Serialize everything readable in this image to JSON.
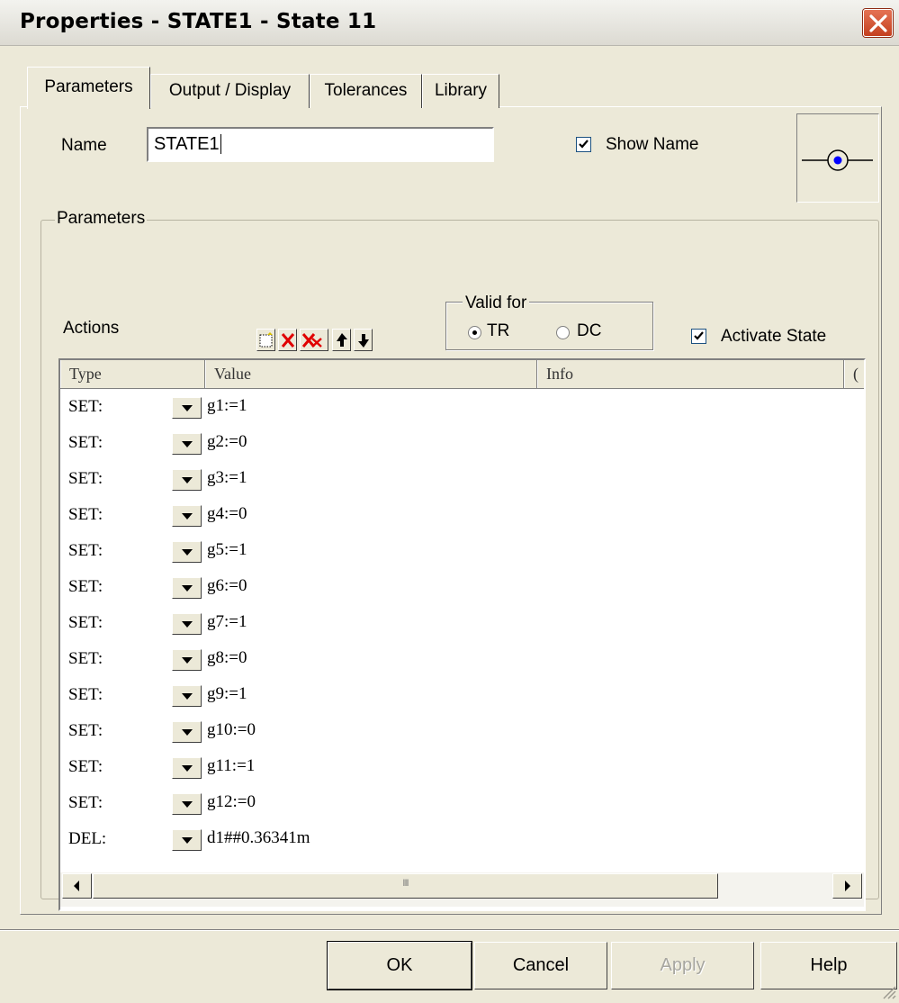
{
  "window": {
    "title": "Properties - STATE1 - State 11",
    "close_label": "close"
  },
  "tabs": [
    {
      "label": "Parameters",
      "active": true
    },
    {
      "label": "Output / Display",
      "active": false
    },
    {
      "label": "Tolerances",
      "active": false
    },
    {
      "label": "Library",
      "active": false
    }
  ],
  "name_field": {
    "label": "Name",
    "value": "STATE1"
  },
  "show_name": {
    "label": "Show Name",
    "checked": true
  },
  "group": {
    "title": "Parameters"
  },
  "actions": {
    "label": "Actions"
  },
  "valid_for": {
    "title": "Valid for",
    "options": [
      "TR",
      "DC"
    ],
    "selected": "TR"
  },
  "activate_state": {
    "label": "Activate State",
    "checked": true
  },
  "toolbar": [
    "new-row-icon",
    "delete-row-icon",
    "delete-all-rows-icon",
    "move-up-icon",
    "move-down-icon"
  ],
  "grid": {
    "columns": [
      "Type",
      "Value",
      "Info",
      "("
    ],
    "rows": [
      {
        "type": "SET:",
        "value": "g1:=1"
      },
      {
        "type": "SET:",
        "value": "g2:=0"
      },
      {
        "type": "SET:",
        "value": "g3:=1"
      },
      {
        "type": "SET:",
        "value": "g4:=0"
      },
      {
        "type": "SET:",
        "value": "g5:=1"
      },
      {
        "type": "SET:",
        "value": "g6:=0"
      },
      {
        "type": "SET:",
        "value": "g7:=1"
      },
      {
        "type": "SET:",
        "value": "g8:=0"
      },
      {
        "type": "SET:",
        "value": "g9:=1"
      },
      {
        "type": "SET:",
        "value": "g10:=0"
      },
      {
        "type": "SET:",
        "value": "g11:=1"
      },
      {
        "type": "SET:",
        "value": "g12:=0"
      },
      {
        "type": "DEL:",
        "value": "d1##0.36341m"
      }
    ],
    "scroll_grip": "III"
  },
  "buttons": {
    "ok": "OK",
    "cancel": "Cancel",
    "apply": "Apply",
    "help": "Help"
  },
  "colors": {
    "accent_blue": "#0000ff",
    "close_red": "#d2502e",
    "delete_red": "#e00000"
  }
}
